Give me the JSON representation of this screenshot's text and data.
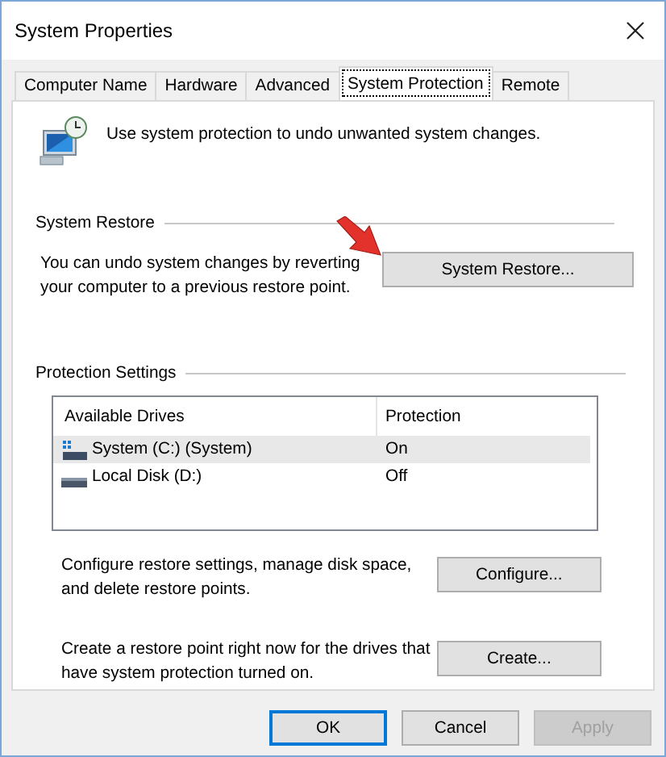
{
  "window": {
    "title": "System Properties"
  },
  "tabs": [
    {
      "label": "Computer Name",
      "selected": false
    },
    {
      "label": "Hardware",
      "selected": false
    },
    {
      "label": "Advanced",
      "selected": false
    },
    {
      "label": "System Protection",
      "selected": true
    },
    {
      "label": "Remote",
      "selected": false
    }
  ],
  "intro": "Use system protection to undo unwanted system changes.",
  "system_restore": {
    "heading": "System Restore",
    "description": "You can undo system changes by reverting your computer to a previous restore point.",
    "button": "System Restore..."
  },
  "protection_settings": {
    "heading": "Protection Settings",
    "columns": [
      "Available Drives",
      "Protection"
    ],
    "rows": [
      {
        "drive": "System (C:) (System)",
        "protection": "On",
        "selected": true,
        "kind": "system"
      },
      {
        "drive": "Local Disk (D:)",
        "protection": "Off",
        "selected": false,
        "kind": "local"
      }
    ],
    "actions": [
      {
        "description": "Configure restore settings, manage disk space, and delete restore points.",
        "button": "Configure..."
      },
      {
        "description": "Create a restore point right now for the drives that have system protection turned on.",
        "button": "Create..."
      }
    ]
  },
  "buttons": [
    {
      "label": "OK",
      "default": true,
      "disabled": false
    },
    {
      "label": "Cancel",
      "default": false,
      "disabled": false
    },
    {
      "label": "Apply",
      "default": false,
      "disabled": true
    }
  ]
}
